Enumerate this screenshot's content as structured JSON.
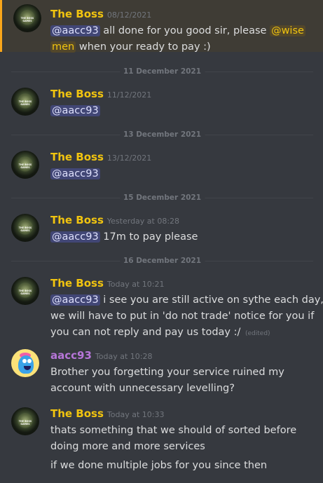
{
  "messages": [
    {
      "author": "The Boss",
      "time": "08/12/2021",
      "lines": [
        "all done for you good sir, please",
        "when your ready to pay :)"
      ],
      "mention": "@aacc93",
      "mention2a": "@wise",
      "mention2b": "men"
    },
    {
      "author": "The Boss",
      "time": "11/12/2021",
      "mention": "@aacc93"
    },
    {
      "author": "The Boss",
      "time": "13/12/2021",
      "mention": "@aacc93"
    },
    {
      "author": "The Boss",
      "time": "Yesterday at 08:28",
      "mention": "@aacc93",
      "text": "17m to pay please"
    },
    {
      "author": "The Boss",
      "time": "Today at 10:21",
      "mention": "@aacc93",
      "lines": [
        "i see you are still active on sythe each day,",
        "we will have to put in 'do not trade' notice for you if",
        "you can not reply and pay us today :/"
      ],
      "edited": "(edited)"
    },
    {
      "author": "aacc93",
      "time": "Today at 10:28",
      "lines": [
        "Brother you forgetting your service ruined my",
        "account with unnecessary levelling?"
      ]
    },
    {
      "author": "The Boss",
      "time": "Today at 10:33",
      "lines": [
        "thats something that we should of sorted before",
        "doing more and more services",
        "if we done multiple jobs for you since then"
      ]
    }
  ],
  "dividers": [
    "11 December 2021",
    "13 December 2021",
    "15 December 2021",
    "16 December 2021"
  ],
  "avatar_text": "THE BOSS GAMES",
  "colors": {
    "boss": "#f1c40f",
    "user": "#b776d9",
    "highlight_border": "#faa61a",
    "mention_bg": "#414675"
  }
}
